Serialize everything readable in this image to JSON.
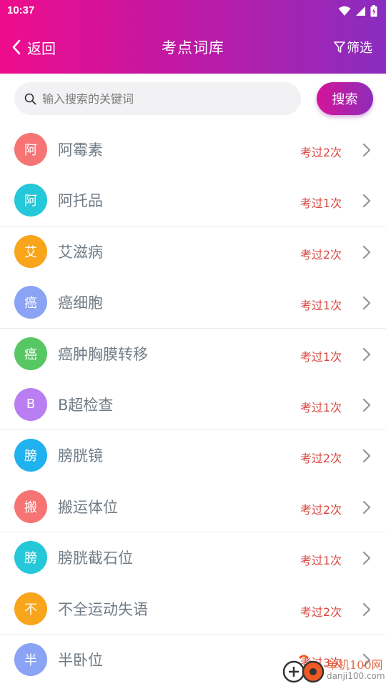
{
  "status_bar": {
    "time": "10:37"
  },
  "nav": {
    "back_label": "返回",
    "title": "考点词库",
    "filter_label": "筛选"
  },
  "search": {
    "placeholder": "输入搜索的关键词",
    "value": "",
    "button_label": "搜索"
  },
  "items": [
    {
      "avatar": "阿",
      "avatar_color": "#f67474",
      "name": "阿霉素",
      "count": "考过2次"
    },
    {
      "avatar": "阿",
      "avatar_color": "#25c8d8",
      "name": "阿托品",
      "count": "考过1次"
    },
    {
      "avatar": "艾",
      "avatar_color": "#f9a51b",
      "name": "艾滋病",
      "count": "考过2次"
    },
    {
      "avatar": "癌",
      "avatar_color": "#8aa3f5",
      "name": "癌细胞",
      "count": "考过1次"
    },
    {
      "avatar": "癌",
      "avatar_color": "#57c764",
      "name": "癌肿胸膜转移",
      "count": "考过1次"
    },
    {
      "avatar": "B",
      "avatar_color": "#b97ef2",
      "name": "B超检查",
      "count": "考过1次"
    },
    {
      "avatar": "膀",
      "avatar_color": "#1fb2ef",
      "name": "膀胱镜",
      "count": "考过2次"
    },
    {
      "avatar": "搬",
      "avatar_color": "#f67474",
      "name": "搬运体位",
      "count": "考过2次"
    },
    {
      "avatar": "膀",
      "avatar_color": "#25c8d8",
      "name": "膀胱截石位",
      "count": "考过1次"
    },
    {
      "avatar": "不",
      "avatar_color": "#f9a51b",
      "name": "不全运动失语",
      "count": "考过2次"
    },
    {
      "avatar": "半",
      "avatar_color": "#8aa3f5",
      "name": "半卧位",
      "count": "考过3次"
    }
  ],
  "watermark": {
    "text": "单机100网",
    "url": "danji100.com"
  }
}
